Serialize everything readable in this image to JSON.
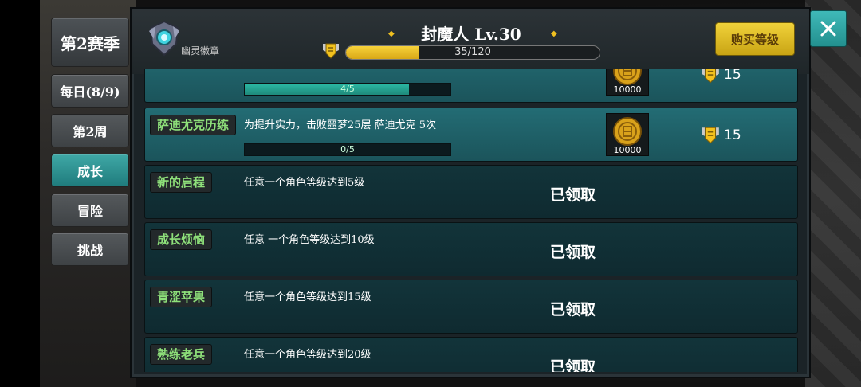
{
  "side_tabs": {
    "season": "第2赛季",
    "daily": "每日(8/9)",
    "week": "第2周",
    "growth": "成长",
    "adventure": "冒险",
    "challenge": "挑战"
  },
  "header": {
    "emblem_label": "幽灵徽章",
    "title": "封魔人  Lv.30",
    "xp_text": "35/120",
    "xp_fraction": 0.29,
    "buy_level_label": "购买等级"
  },
  "tasks": [
    {
      "name": "",
      "desc": "",
      "progress_text": "4/5",
      "progress_fraction": 0.8,
      "coin_qty": "10000",
      "reward": "15"
    },
    {
      "name": "萨迪尤克历练",
      "desc": "为提升实力，击败噩梦25层  萨迪尤克  5次",
      "progress_text": "0/5",
      "progress_fraction": 0,
      "coin_qty": "10000",
      "reward": "15"
    },
    {
      "name": "新的启程",
      "desc": "任意一个角色等级达到5级",
      "status": "已领取"
    },
    {
      "name": "成长烦恼",
      "desc": "任意  一个角色等级达到10级",
      "status": "已领取"
    },
    {
      "name": "青涩苹果",
      "desc": "任意一个角色等级达到15级",
      "status": "已领取"
    },
    {
      "name": "熟练老兵",
      "desc": "任意一个角色等级达到20级",
      "status": "已领取"
    }
  ],
  "colors": {
    "accent_teal": "#2a9f9f",
    "gold": "#e8c21c",
    "task_name_green": "#8ee07a"
  }
}
